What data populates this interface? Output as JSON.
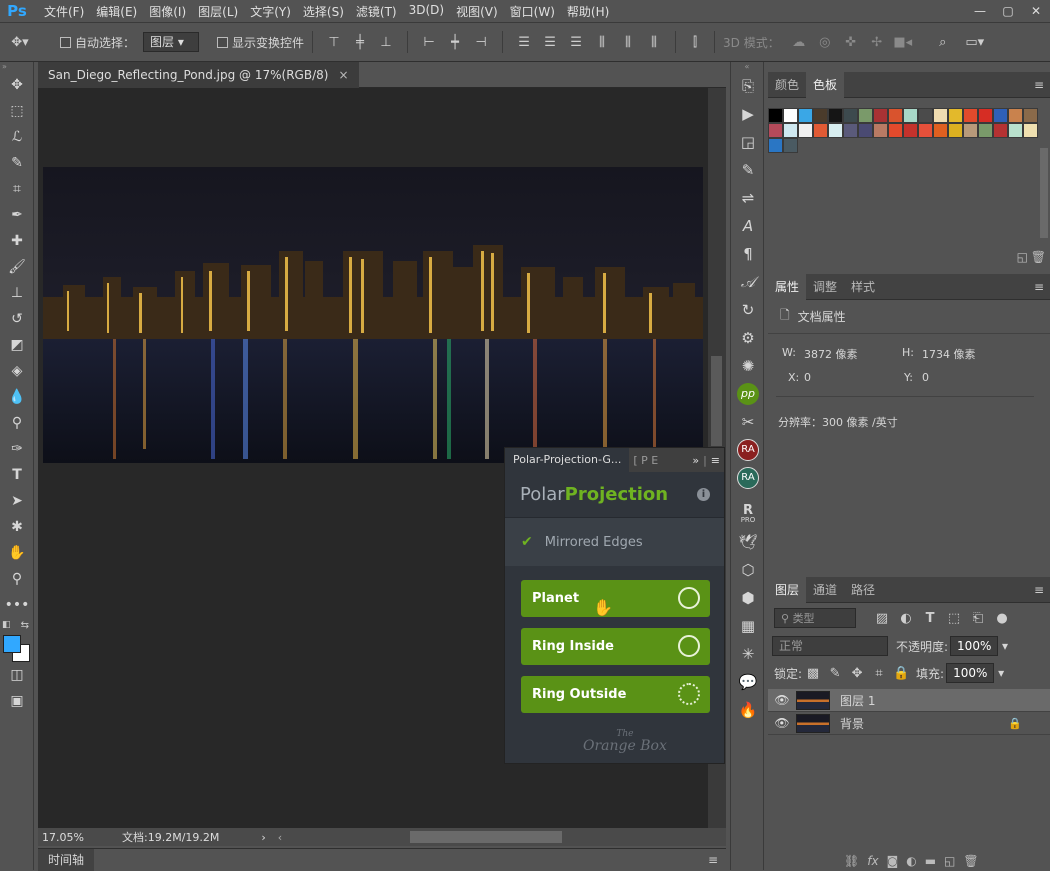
{
  "app": {
    "logo": "Ps"
  },
  "menu": [
    "文件(F)",
    "编辑(E)",
    "图像(I)",
    "图层(L)",
    "文字(Y)",
    "选择(S)",
    "滤镜(T)",
    "3D(D)",
    "视图(V)",
    "窗口(W)",
    "帮助(H)"
  ],
  "window_controls": [
    "—",
    "▢",
    "✕"
  ],
  "options_bar": {
    "auto_select_label": "自动选择：",
    "auto_select_value": "图层",
    "show_transform_label": "显示变换控件",
    "mode_3d_label": "3D 模式："
  },
  "document": {
    "tab_title": "San_Diego_Reflecting_Pond.jpg @ 17%(RGB/8)",
    "close_glyph": "×",
    "zoom": "17.05%",
    "doc_size": "文档:19.2M/19.2M",
    "scroll_next": "›",
    "scroll_prev": "‹"
  },
  "timeline": {
    "label": "时间轴"
  },
  "color_panel": {
    "tabs": [
      "颜色",
      "色板"
    ],
    "swatches": [
      "#000000",
      "#ffffff",
      "#3aa7e6",
      "#4a3b2b",
      "#151515",
      "#3d4a4e",
      "#7a9a6a",
      "#a83234",
      "#d9532d",
      "#a8d8c8",
      "#4b4b4b",
      "#efdcb0",
      "#e3b92b",
      "#e14a2c",
      "#d62d24",
      "#2f60b7",
      "#c9824d",
      "#8a6a4a",
      "#b44a5a",
      "#cfe8f0",
      "#f0f0f0",
      "#e05a34",
      "#d8eef0",
      "#5a5a7a",
      "#4a4a72",
      "#b87a64",
      "#e34a2c",
      "#c4322c",
      "#e6503a",
      "#e06020",
      "#dcb020",
      "#b89a7a",
      "#7a9a6a",
      "#b43232",
      "#b8e0cc",
      "#efe0b0",
      "#2a76c4",
      "#4a5a62"
    ]
  },
  "properties_panel": {
    "tabs": [
      "属性",
      "调整",
      "样式"
    ],
    "header": "文档属性",
    "w_label": "W:",
    "w_value": "3872 像素",
    "h_label": "H:",
    "h_value": "1734 像素",
    "x_label": "X:",
    "x_value": "0",
    "y_label": "Y:",
    "y_value": "0",
    "resolution": "分辨率：300 像素 /英寸"
  },
  "layers_panel": {
    "tabs": [
      "图层",
      "通道",
      "路径"
    ],
    "filter_placeholder": "类型",
    "blend_mode": "正常",
    "opacity_label": "不透明度:",
    "opacity_value": "100%",
    "lock_label": "锁定:",
    "fill_label": "填充:",
    "fill_value": "100%",
    "layers": [
      {
        "name": "图层 1",
        "selected": true,
        "locked": false
      },
      {
        "name": "背景",
        "selected": false,
        "locked": true
      }
    ]
  },
  "plugin": {
    "tab_title": "Polar-Projection-G...",
    "tab_extra": "[ P E",
    "title_a": "Polar",
    "title_b": "Projection",
    "option_label": "Mirrored Edges",
    "buttons": [
      "Planet",
      "Ring Inside",
      "Ring Outside"
    ],
    "footer_a": "The",
    "footer_b": "Orange Box"
  },
  "strip_badges": {
    "pp": "pp",
    "ra1": "RA",
    "ra2": "RA",
    "rpro": "R",
    "rpro_sub": "PRO"
  },
  "colors": {
    "accent": "#31a8ff",
    "plugin_green": "#5a9216",
    "plugin_title_green": "#6fb321"
  }
}
